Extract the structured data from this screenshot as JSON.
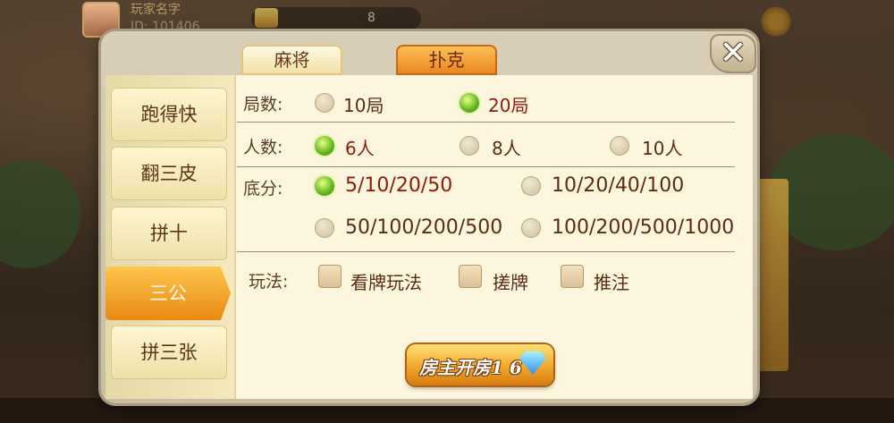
{
  "topbar": {
    "player_name": "玩家名字",
    "player_id": "ID: 101406",
    "coins": "8"
  },
  "tabs": [
    {
      "label": "麻将",
      "active": false
    },
    {
      "label": "扑克",
      "active": true
    }
  ],
  "close": {
    "label": "✕"
  },
  "sidebar": {
    "items": [
      {
        "label": "跑得快",
        "active": false
      },
      {
        "label": "翻三皮",
        "active": false
      },
      {
        "label": "拼十",
        "active": false
      },
      {
        "label": "三公",
        "active": true
      },
      {
        "label": "拼三张",
        "active": false
      }
    ]
  },
  "settings": {
    "rounds": {
      "label": "局数:",
      "options": [
        {
          "label": "10局",
          "selected": false
        },
        {
          "label": "20局",
          "selected": true
        }
      ]
    },
    "players": {
      "label": "人数:",
      "options": [
        {
          "label": "6人",
          "selected": true
        },
        {
          "label": "8人",
          "selected": false
        },
        {
          "label": "10人",
          "selected": false
        }
      ]
    },
    "base_score": {
      "label": "底分:",
      "options": [
        {
          "label": "5/10/20/50",
          "selected": true
        },
        {
          "label": "10/20/40/100",
          "selected": false
        },
        {
          "label": "50/100/200/500",
          "selected": false
        },
        {
          "label": "100/200/500/1000",
          "selected": false
        }
      ]
    },
    "rules": {
      "label": "玩法:",
      "options": [
        {
          "label": "看牌玩法",
          "checked": false
        },
        {
          "label": "搓牌",
          "checked": false
        },
        {
          "label": "推注",
          "checked": false
        }
      ]
    }
  },
  "create_button": {
    "label": "房主开房1 6"
  },
  "colors": {
    "accent_orange": "#e88a12",
    "selected_green": "#5fb41a",
    "panel_bg": "#fdf6de",
    "text_brown": "#5b2b12"
  }
}
